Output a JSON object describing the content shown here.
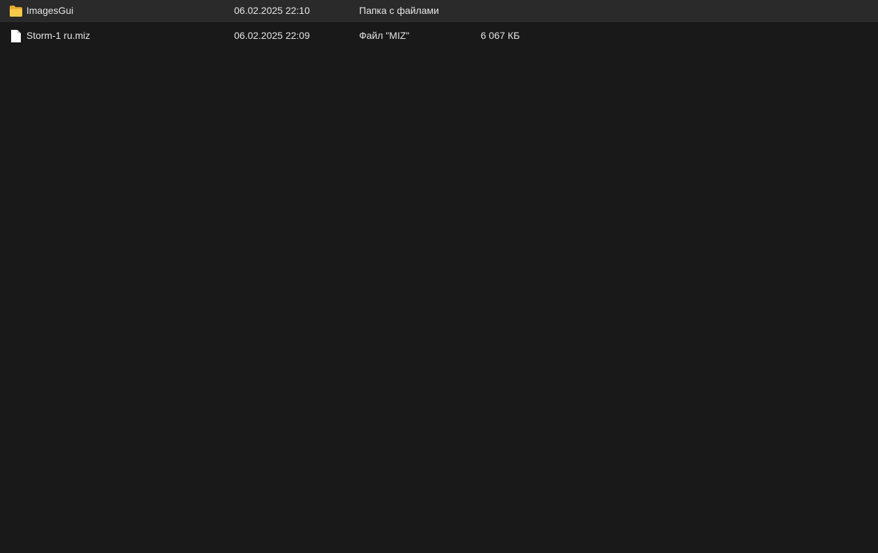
{
  "files": [
    {
      "name": "ImagesGui",
      "modified": "06.02.2025 22:10",
      "type": "Папка с файлами",
      "size": "",
      "icon": "folder-icon"
    },
    {
      "name": "Storm-1 ru.miz",
      "modified": "06.02.2025 22:09",
      "type": "Файл \"MIZ\"",
      "size": "6 067 КБ",
      "icon": "file-icon"
    }
  ],
  "colors": {
    "background": "#191919",
    "text": "#e6e6e6",
    "folder": "#f4c24d",
    "file": "#ffffff"
  }
}
